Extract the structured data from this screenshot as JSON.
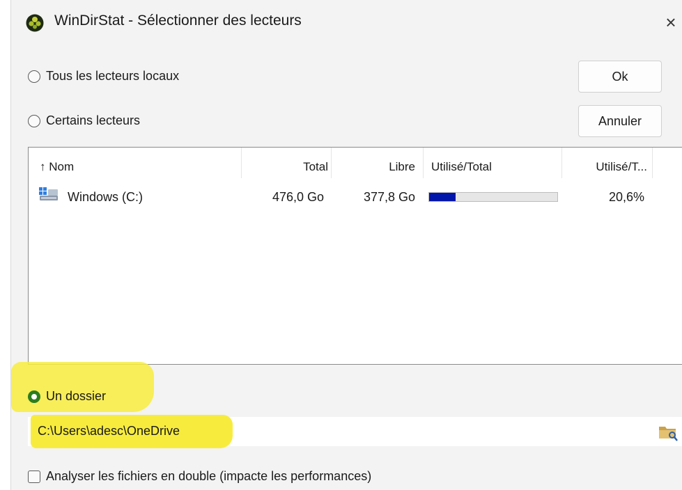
{
  "window": {
    "title": "WinDirStat - Sélectionner des lecteurs",
    "close_glyph": "×"
  },
  "options": {
    "all_local": "Tous les lecteurs locaux",
    "some_drives": "Certains lecteurs",
    "folder": "Un dossier",
    "selected": "folder"
  },
  "buttons": {
    "ok": "Ok",
    "cancel": "Annuler"
  },
  "drive_list": {
    "columns": [
      "↑ Nom",
      "Total",
      "Libre",
      "Utilisé/Total",
      "Utilisé/T..."
    ],
    "rows": [
      {
        "name": "Windows (C:)",
        "total": "476,0 Go",
        "free": "377,8 Go",
        "used_fraction": 0.206,
        "used_percent": "20,6%"
      }
    ]
  },
  "folder_path": "C:\\Users\\adesc\\OneDrive",
  "duplicates_checkbox": {
    "label": "Analyser les fichiers en double (impacte les performances)",
    "checked": false
  },
  "colors": {
    "usage_bar": "#0015aa",
    "highlight": "#f7ec3e",
    "radio_selected": "#2d7d1f"
  }
}
